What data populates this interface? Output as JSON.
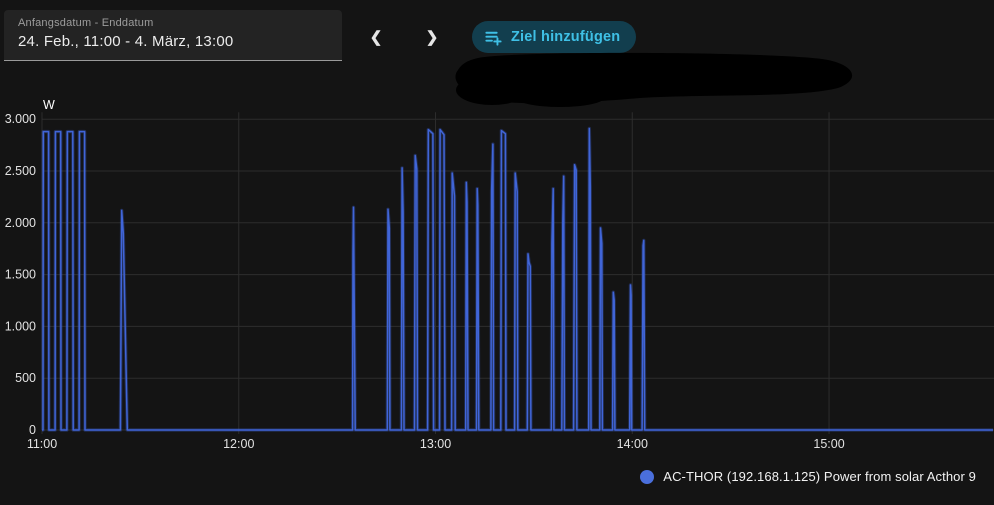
{
  "header": {
    "date_range": {
      "label": "Anfangsdatum - Enddatum",
      "value": "24. Feb., 11:00 - 4. März, 13:00"
    },
    "prev_icon": "❮",
    "next_icon": "❯",
    "add_target_button": {
      "label": "Ziel hinzufügen",
      "icon": "playlist-add-icon"
    }
  },
  "legend": {
    "label": "AC-THOR (192.168.1.125) Power from solar Acthor 9",
    "dot_color": "#4a6fdc"
  },
  "colors": {
    "background": "#141414",
    "grid": "#2d2d2d",
    "axis_text": "#e2e2e2",
    "series_line": "#4065d8",
    "accent_cyan": "#3fc0e6",
    "button_bg": "#123e4e"
  },
  "chart_data": {
    "type": "line",
    "title": "",
    "unit_label": "W",
    "xlabel": "",
    "ylabel": "W",
    "grid": true,
    "legend_position": "bottom-right",
    "ylim": [
      0,
      3000
    ],
    "x_range_minutes": [
      0,
      290
    ],
    "y_ticks": [
      {
        "value": 0,
        "label": "0"
      },
      {
        "value": 500,
        "label": "500"
      },
      {
        "value": 1000,
        "label": "1.000"
      },
      {
        "value": 1500,
        "label": "1.500"
      },
      {
        "value": 2000,
        "label": "2.000"
      },
      {
        "value": 2500,
        "label": "2.500"
      },
      {
        "value": 3000,
        "label": "3.000"
      }
    ],
    "x_ticks": [
      {
        "minute": 0,
        "label": "11:00"
      },
      {
        "minute": 60,
        "label": "12:00"
      },
      {
        "minute": 120,
        "label": "13:00"
      },
      {
        "minute": 180,
        "label": "14:00"
      },
      {
        "minute": 240,
        "label": "15:00"
      }
    ],
    "series": [
      {
        "name": "AC-THOR (192.168.1.125) Power from solar Acthor 9",
        "color": "#4065d8",
        "points_minute_watt": [
          [
            0,
            0
          ],
          [
            0.3,
            0
          ],
          [
            0.4,
            2880
          ],
          [
            2.0,
            2880
          ],
          [
            2.1,
            0
          ],
          [
            4.0,
            0
          ],
          [
            4.1,
            2880
          ],
          [
            5.7,
            2880
          ],
          [
            5.8,
            0
          ],
          [
            7.6,
            0
          ],
          [
            7.7,
            2880
          ],
          [
            9.4,
            2880
          ],
          [
            9.5,
            0
          ],
          [
            11.3,
            0
          ],
          [
            11.4,
            2880
          ],
          [
            13.0,
            2880
          ],
          [
            13.1,
            0
          ],
          [
            23.9,
            0
          ],
          [
            24.3,
            2120
          ],
          [
            24.8,
            1900
          ],
          [
            26.0,
            0
          ],
          [
            94.7,
            0
          ],
          [
            94.85,
            1700
          ],
          [
            95.0,
            2150
          ],
          [
            95.5,
            0
          ],
          [
            105.3,
            0
          ],
          [
            105.5,
            2130
          ],
          [
            105.9,
            1950
          ],
          [
            106.1,
            0
          ],
          [
            109.6,
            0
          ],
          [
            109.8,
            2530
          ],
          [
            110.1,
            2100
          ],
          [
            110.4,
            0
          ],
          [
            113.6,
            0
          ],
          [
            113.8,
            2650
          ],
          [
            114.3,
            2520
          ],
          [
            114.5,
            0
          ],
          [
            117.6,
            0
          ],
          [
            117.8,
            2900
          ],
          [
            119.2,
            2860
          ],
          [
            119.4,
            0
          ],
          [
            121.2,
            0
          ],
          [
            121.4,
            2900
          ],
          [
            122.6,
            2850
          ],
          [
            122.9,
            0
          ],
          [
            124.9,
            0
          ],
          [
            125.1,
            2480
          ],
          [
            125.8,
            2260
          ],
          [
            126.0,
            0
          ],
          [
            129.2,
            0
          ],
          [
            129.4,
            2390
          ],
          [
            129.6,
            2200
          ],
          [
            129.9,
            0
          ],
          [
            132.5,
            0
          ],
          [
            132.7,
            2330
          ],
          [
            132.9,
            2170
          ],
          [
            133.2,
            0
          ],
          [
            136.9,
            0
          ],
          [
            137.1,
            2300
          ],
          [
            137.5,
            2760
          ],
          [
            137.7,
            0
          ],
          [
            139.9,
            0
          ],
          [
            140.1,
            2890
          ],
          [
            141.3,
            2860
          ],
          [
            141.5,
            0
          ],
          [
            144.1,
            0
          ],
          [
            144.3,
            2480
          ],
          [
            144.9,
            2300
          ],
          [
            145.1,
            0
          ],
          [
            148.0,
            0
          ],
          [
            148.2,
            1700
          ],
          [
            148.5,
            1620
          ],
          [
            148.9,
            1580
          ],
          [
            149.1,
            0
          ],
          [
            155.3,
            0
          ],
          [
            155.5,
            1800
          ],
          [
            155.9,
            2330
          ],
          [
            156.1,
            0
          ],
          [
            158.5,
            0
          ],
          [
            158.8,
            2000
          ],
          [
            159.1,
            2450
          ],
          [
            159.3,
            0
          ],
          [
            162.1,
            0
          ],
          [
            162.4,
            2560
          ],
          [
            162.9,
            2510
          ],
          [
            163.1,
            0
          ],
          [
            166.7,
            0
          ],
          [
            166.9,
            2910
          ],
          [
            167.2,
            2350
          ],
          [
            167.4,
            0
          ],
          [
            170.1,
            0
          ],
          [
            170.3,
            1950
          ],
          [
            170.7,
            1800
          ],
          [
            170.9,
            0
          ],
          [
            174.0,
            0
          ],
          [
            174.2,
            1330
          ],
          [
            174.5,
            1250
          ],
          [
            174.7,
            0
          ],
          [
            179.2,
            0
          ],
          [
            179.45,
            1400
          ],
          [
            179.65,
            1300
          ],
          [
            179.8,
            0
          ],
          [
            183.0,
            0
          ],
          [
            183.3,
            1780
          ],
          [
            183.5,
            1830
          ],
          [
            183.8,
            0
          ],
          [
            290,
            0
          ]
        ]
      }
    ]
  }
}
